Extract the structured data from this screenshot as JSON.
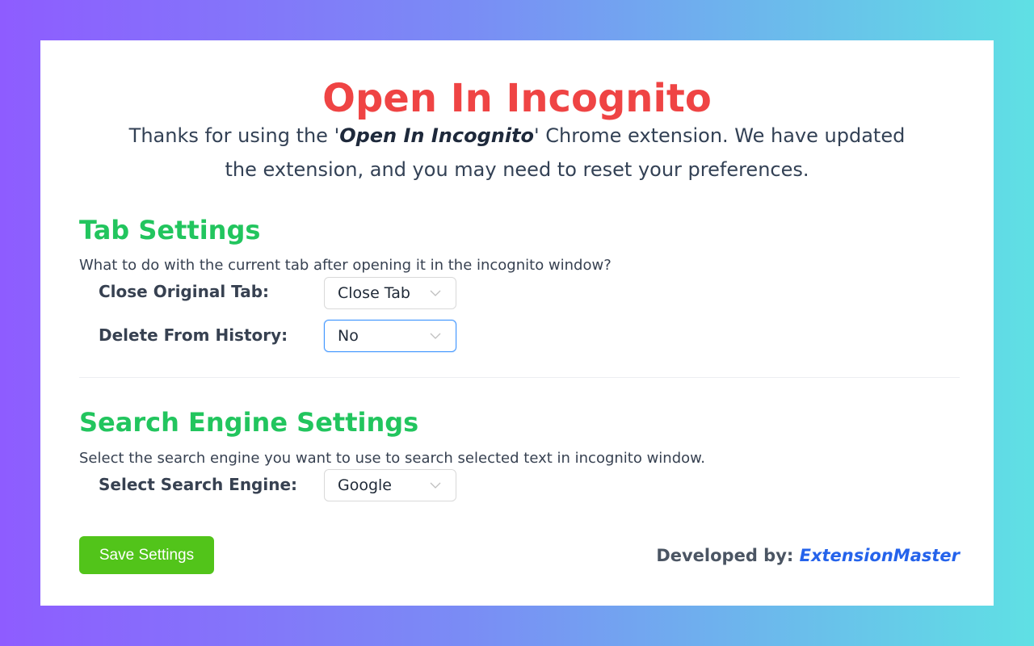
{
  "header": {
    "title": "Open In Incognito",
    "intro_prefix": "Thanks for using the '",
    "intro_strong": "Open In Incognito",
    "intro_suffix": "' Chrome extension. We have updated the extension, and you may need to reset your preferences."
  },
  "tab_settings": {
    "title": "Tab Settings",
    "description": "What to do with the current tab after opening it in the incognito window?",
    "close_original_label": "Close Original Tab:",
    "close_original_value": "Close Tab",
    "delete_history_label": "Delete From History:",
    "delete_history_value": "No"
  },
  "search_settings": {
    "title": "Search Engine Settings",
    "description": "Select the search engine you want to use to search selected text in incognito window.",
    "engine_label": "Select Search Engine:",
    "engine_value": "Google"
  },
  "footer": {
    "save_label": "Save Settings",
    "developed_by_label": "Developed by: ",
    "developer_name": "ExtensionMaster"
  },
  "colors": {
    "title": "#ef4444",
    "section_title": "#22c55e",
    "save_button": "#52c41a",
    "link": "#2563eb",
    "focus_border": "#4096ff"
  },
  "icons": {
    "select_arrow": "chevron-down-icon"
  }
}
